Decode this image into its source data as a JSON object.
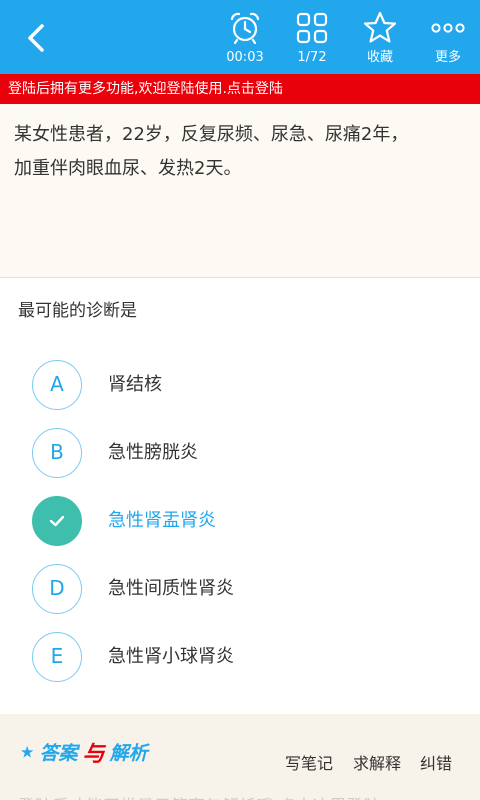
{
  "header": {
    "timer_label": "00:03",
    "progress_label": "1/72",
    "favorite_label": "收藏",
    "more_label": "更多"
  },
  "banner": {
    "text": "登陆后拥有更多功能,欢迎登陆使用.点击登陆"
  },
  "question": {
    "stem": "某女性患者，22岁，反复尿频、尿急、尿痛2年，加重伴肉眼血尿、发热2天。",
    "ask": "最可能的诊断是",
    "options": [
      {
        "letter": "A",
        "text": "肾结核"
      },
      {
        "letter": "B",
        "text": "急性膀胱炎"
      },
      {
        "letter": "C",
        "text": "急性肾盂肾炎"
      },
      {
        "letter": "D",
        "text": "急性间质性肾炎"
      },
      {
        "letter": "E",
        "text": "急性肾小球肾炎"
      }
    ],
    "selected": "C"
  },
  "answer_panel": {
    "title_star": "★",
    "title_a": "答案",
    "title_b": "与",
    "title_c": "解析",
    "write_note": "写笔记",
    "ask_explain": "求解释",
    "correct_error": "纠错",
    "hint": "登陆后才能正常显示答案与解析哦,点击这里登陆"
  },
  "colors": {
    "header_bg": "#22a6ec",
    "banner_bg": "#e8000a",
    "selected_circle": "#3ebfad",
    "accent_blue": "#22a6ec"
  }
}
